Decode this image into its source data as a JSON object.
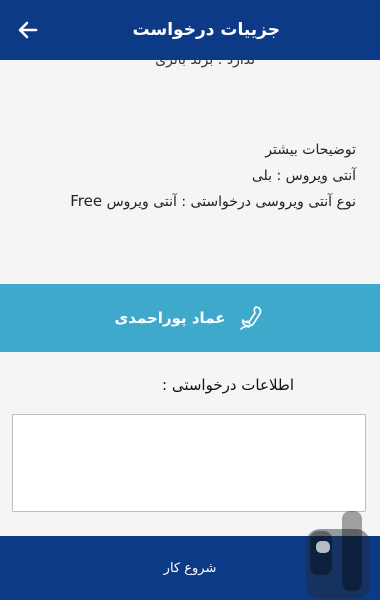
{
  "header": {
    "title": "جزییات درخواست",
    "back_icon": "arrow-left-icon",
    "bg": "#0d3a86"
  },
  "details": {
    "cut_line": "ندارد : برند باتری",
    "more_label": "توضیحات بیشتر",
    "antivirus_line": "آنتی ویروس : بلی",
    "antivirus_type_line": "نوع آنتی ویروسی درخواستی : آنتی ویروس",
    "antivirus_type_value": "Free"
  },
  "contact": {
    "name": "عماد پوراحمدی",
    "icon": "phone-icon",
    "bg": "#3fa9cc"
  },
  "request": {
    "label": "اطلاعات درخواستی :",
    "value": ""
  },
  "footer": {
    "start_label": "شروع کار",
    "bg": "#0d3a86"
  },
  "watermark": {
    "icon": "bazaar-logo-icon"
  }
}
